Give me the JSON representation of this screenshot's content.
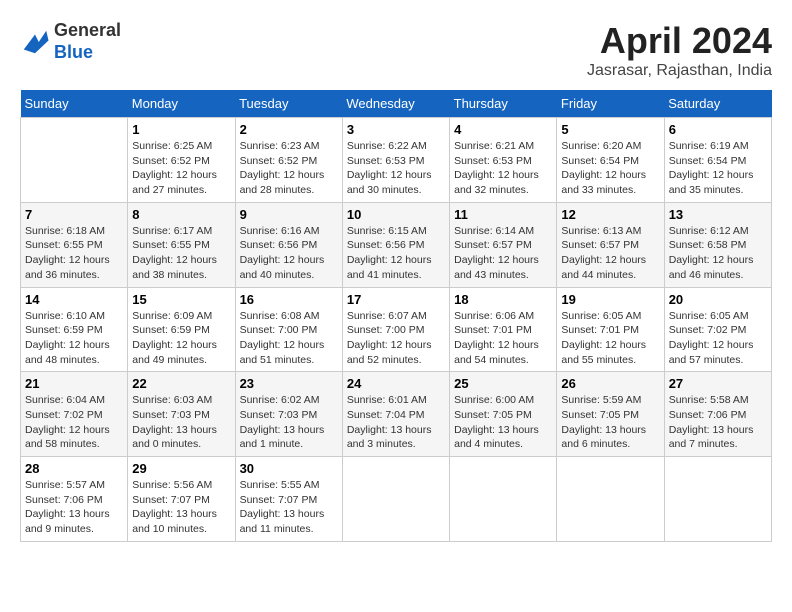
{
  "header": {
    "logo_line1": "General",
    "logo_line2": "Blue",
    "month_year": "April 2024",
    "location": "Jasrasar, Rajasthan, India"
  },
  "days_of_week": [
    "Sunday",
    "Monday",
    "Tuesday",
    "Wednesday",
    "Thursday",
    "Friday",
    "Saturday"
  ],
  "weeks": [
    [
      {
        "day": "",
        "info": ""
      },
      {
        "day": "1",
        "info": "Sunrise: 6:25 AM\nSunset: 6:52 PM\nDaylight: 12 hours\nand 27 minutes."
      },
      {
        "day": "2",
        "info": "Sunrise: 6:23 AM\nSunset: 6:52 PM\nDaylight: 12 hours\nand 28 minutes."
      },
      {
        "day": "3",
        "info": "Sunrise: 6:22 AM\nSunset: 6:53 PM\nDaylight: 12 hours\nand 30 minutes."
      },
      {
        "day": "4",
        "info": "Sunrise: 6:21 AM\nSunset: 6:53 PM\nDaylight: 12 hours\nand 32 minutes."
      },
      {
        "day": "5",
        "info": "Sunrise: 6:20 AM\nSunset: 6:54 PM\nDaylight: 12 hours\nand 33 minutes."
      },
      {
        "day": "6",
        "info": "Sunrise: 6:19 AM\nSunset: 6:54 PM\nDaylight: 12 hours\nand 35 minutes."
      }
    ],
    [
      {
        "day": "7",
        "info": "Sunrise: 6:18 AM\nSunset: 6:55 PM\nDaylight: 12 hours\nand 36 minutes."
      },
      {
        "day": "8",
        "info": "Sunrise: 6:17 AM\nSunset: 6:55 PM\nDaylight: 12 hours\nand 38 minutes."
      },
      {
        "day": "9",
        "info": "Sunrise: 6:16 AM\nSunset: 6:56 PM\nDaylight: 12 hours\nand 40 minutes."
      },
      {
        "day": "10",
        "info": "Sunrise: 6:15 AM\nSunset: 6:56 PM\nDaylight: 12 hours\nand 41 minutes."
      },
      {
        "day": "11",
        "info": "Sunrise: 6:14 AM\nSunset: 6:57 PM\nDaylight: 12 hours\nand 43 minutes."
      },
      {
        "day": "12",
        "info": "Sunrise: 6:13 AM\nSunset: 6:57 PM\nDaylight: 12 hours\nand 44 minutes."
      },
      {
        "day": "13",
        "info": "Sunrise: 6:12 AM\nSunset: 6:58 PM\nDaylight: 12 hours\nand 46 minutes."
      }
    ],
    [
      {
        "day": "14",
        "info": "Sunrise: 6:10 AM\nSunset: 6:59 PM\nDaylight: 12 hours\nand 48 minutes."
      },
      {
        "day": "15",
        "info": "Sunrise: 6:09 AM\nSunset: 6:59 PM\nDaylight: 12 hours\nand 49 minutes."
      },
      {
        "day": "16",
        "info": "Sunrise: 6:08 AM\nSunset: 7:00 PM\nDaylight: 12 hours\nand 51 minutes."
      },
      {
        "day": "17",
        "info": "Sunrise: 6:07 AM\nSunset: 7:00 PM\nDaylight: 12 hours\nand 52 minutes."
      },
      {
        "day": "18",
        "info": "Sunrise: 6:06 AM\nSunset: 7:01 PM\nDaylight: 12 hours\nand 54 minutes."
      },
      {
        "day": "19",
        "info": "Sunrise: 6:05 AM\nSunset: 7:01 PM\nDaylight: 12 hours\nand 55 minutes."
      },
      {
        "day": "20",
        "info": "Sunrise: 6:05 AM\nSunset: 7:02 PM\nDaylight: 12 hours\nand 57 minutes."
      }
    ],
    [
      {
        "day": "21",
        "info": "Sunrise: 6:04 AM\nSunset: 7:02 PM\nDaylight: 12 hours\nand 58 minutes."
      },
      {
        "day": "22",
        "info": "Sunrise: 6:03 AM\nSunset: 7:03 PM\nDaylight: 13 hours\nand 0 minutes."
      },
      {
        "day": "23",
        "info": "Sunrise: 6:02 AM\nSunset: 7:03 PM\nDaylight: 13 hours\nand 1 minute."
      },
      {
        "day": "24",
        "info": "Sunrise: 6:01 AM\nSunset: 7:04 PM\nDaylight: 13 hours\nand 3 minutes."
      },
      {
        "day": "25",
        "info": "Sunrise: 6:00 AM\nSunset: 7:05 PM\nDaylight: 13 hours\nand 4 minutes."
      },
      {
        "day": "26",
        "info": "Sunrise: 5:59 AM\nSunset: 7:05 PM\nDaylight: 13 hours\nand 6 minutes."
      },
      {
        "day": "27",
        "info": "Sunrise: 5:58 AM\nSunset: 7:06 PM\nDaylight: 13 hours\nand 7 minutes."
      }
    ],
    [
      {
        "day": "28",
        "info": "Sunrise: 5:57 AM\nSunset: 7:06 PM\nDaylight: 13 hours\nand 9 minutes."
      },
      {
        "day": "29",
        "info": "Sunrise: 5:56 AM\nSunset: 7:07 PM\nDaylight: 13 hours\nand 10 minutes."
      },
      {
        "day": "30",
        "info": "Sunrise: 5:55 AM\nSunset: 7:07 PM\nDaylight: 13 hours\nand 11 minutes."
      },
      {
        "day": "",
        "info": ""
      },
      {
        "day": "",
        "info": ""
      },
      {
        "day": "",
        "info": ""
      },
      {
        "day": "",
        "info": ""
      }
    ]
  ]
}
